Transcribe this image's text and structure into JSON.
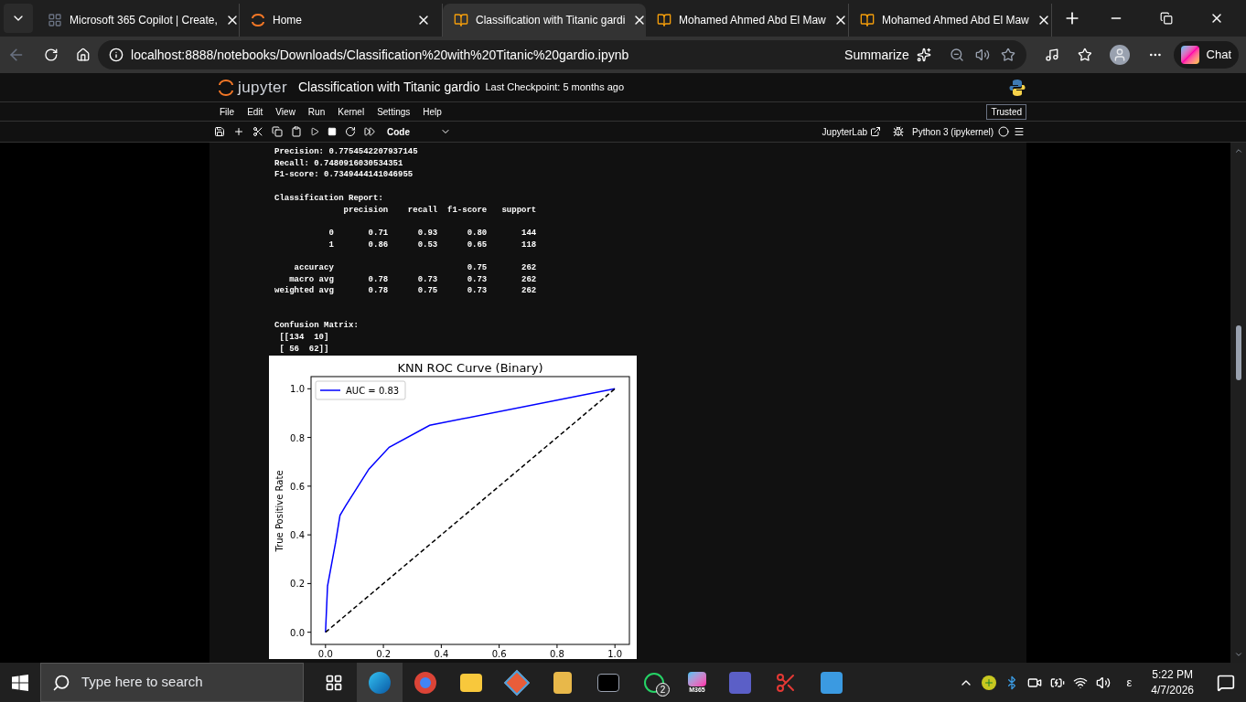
{
  "browser": {
    "tabs": [
      {
        "title": "Microsoft 365 Copilot | Create,",
        "selected": false,
        "kind": "app"
      },
      {
        "title": "Home",
        "selected": false,
        "kind": "home"
      },
      {
        "title": "Classification with Titanic gardi",
        "selected": true,
        "kind": "notebook"
      },
      {
        "title": "Mohamed Ahmed Abd El Maw",
        "selected": false,
        "kind": "notebook"
      },
      {
        "title": "Mohamed Ahmed Abd El Maw",
        "selected": false,
        "kind": "notebook"
      }
    ],
    "url": "localhost:8888/notebooks/Downloads/Classification%20with%20Titanic%20gardio.ipynb",
    "summarize": "Summarize",
    "chat": "Chat"
  },
  "jupyter": {
    "logo": "jupyter",
    "title": "Classification with Titanic gardio",
    "checkpoint": "Last Checkpoint: 5 months ago",
    "menu": [
      "File",
      "Edit",
      "View",
      "Run",
      "Kernel",
      "Settings",
      "Help"
    ],
    "trusted": "Trusted",
    "cell_type": "Code",
    "jupyterlab": "JupyterLab",
    "kernel": "Python 3 (ipykernel)"
  },
  "output_blocks": [
    [
      "Precision: 0.7754542207937145",
      "Recall: 0.7480916030534351",
      "F1-score: 0.7349444141046955"
    ],
    [
      "Classification Report:",
      "              precision    recall  f1-score   support"
    ],
    [
      "           0       0.71      0.93      0.80       144",
      "           1       0.86      0.53      0.65       118"
    ],
    [
      "    accuracy                           0.75       262",
      "   macro avg       0.78      0.73      0.73       262",
      "weighted avg       0.78      0.75      0.73       262"
    ],
    [
      "Confusion Matrix:",
      " [[134  10]",
      " [ 56  62]]"
    ]
  ],
  "chart_data": {
    "type": "line",
    "title": "KNN ROC Curve (Binary)",
    "ylabel": "True Positive Rate",
    "x": [
      0,
      0.007,
      0.035,
      0.05,
      0.07,
      0.15,
      0.22,
      0.36,
      1.0
    ],
    "series": [
      {
        "name": "AUC = 0.83",
        "color": "#0000ff",
        "line_style": "solid",
        "values": [
          0,
          0.19,
          0.37,
          0.48,
          0.52,
          0.67,
          0.76,
          0.85,
          1.0
        ]
      },
      {
        "color": "#000000",
        "line_style": "dashed",
        "values": [
          0,
          0.007,
          0.035,
          0.05,
          0.07,
          0.15,
          0.22,
          0.36,
          1.0
        ]
      }
    ],
    "xlim": [
      -0.05,
      1.05
    ],
    "ylim": [
      -0.05,
      1.05
    ],
    "xticks": [
      {
        "value": 0,
        "label": "0.0"
      },
      0.2,
      0.4,
      0.6,
      0.8,
      {
        "value": 1,
        "label": "1.0"
      }
    ],
    "yticks": [
      {
        "value": 0,
        "label": "0.0"
      },
      0.2,
      0.4,
      0.6,
      0.8,
      {
        "value": 1,
        "label": "1.0"
      }
    ]
  },
  "taskbar": {
    "search_placeholder": "Type here to search",
    "whatsapp_badge": "2",
    "m365_label": "M365",
    "ime": "ε",
    "time": "5:22 PM",
    "date": "4/7/2026"
  }
}
